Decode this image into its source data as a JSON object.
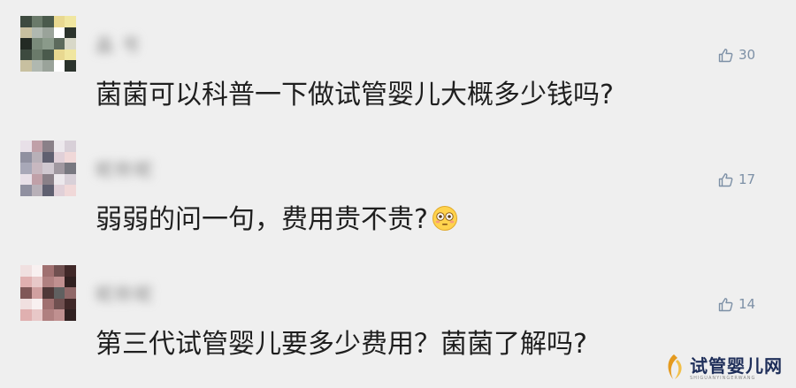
{
  "comments": [
    {
      "nickname": "晶 号",
      "likes": "30",
      "text": "菌菌可以科普一下做试管婴儿大概多少钱吗?",
      "emoji": ""
    },
    {
      "nickname": "昵称昵",
      "likes": "17",
      "text": "弱弱的问一句，费用贵不贵?",
      "emoji": "flushed-face-icon"
    },
    {
      "nickname": "昵称昵",
      "likes": "14",
      "text": "第三代试管婴儿要多少费用？菌菌了解吗?",
      "emoji": ""
    }
  ],
  "watermark": {
    "brand": "试管婴儿网",
    "sub": "SHIGUANYINGERWANG"
  },
  "colors": {
    "background": "#efefef",
    "like": "#7d90a6",
    "text": "#1f1f1f",
    "brand": "#1e2e59",
    "brand_accent": "#e49a1f"
  }
}
